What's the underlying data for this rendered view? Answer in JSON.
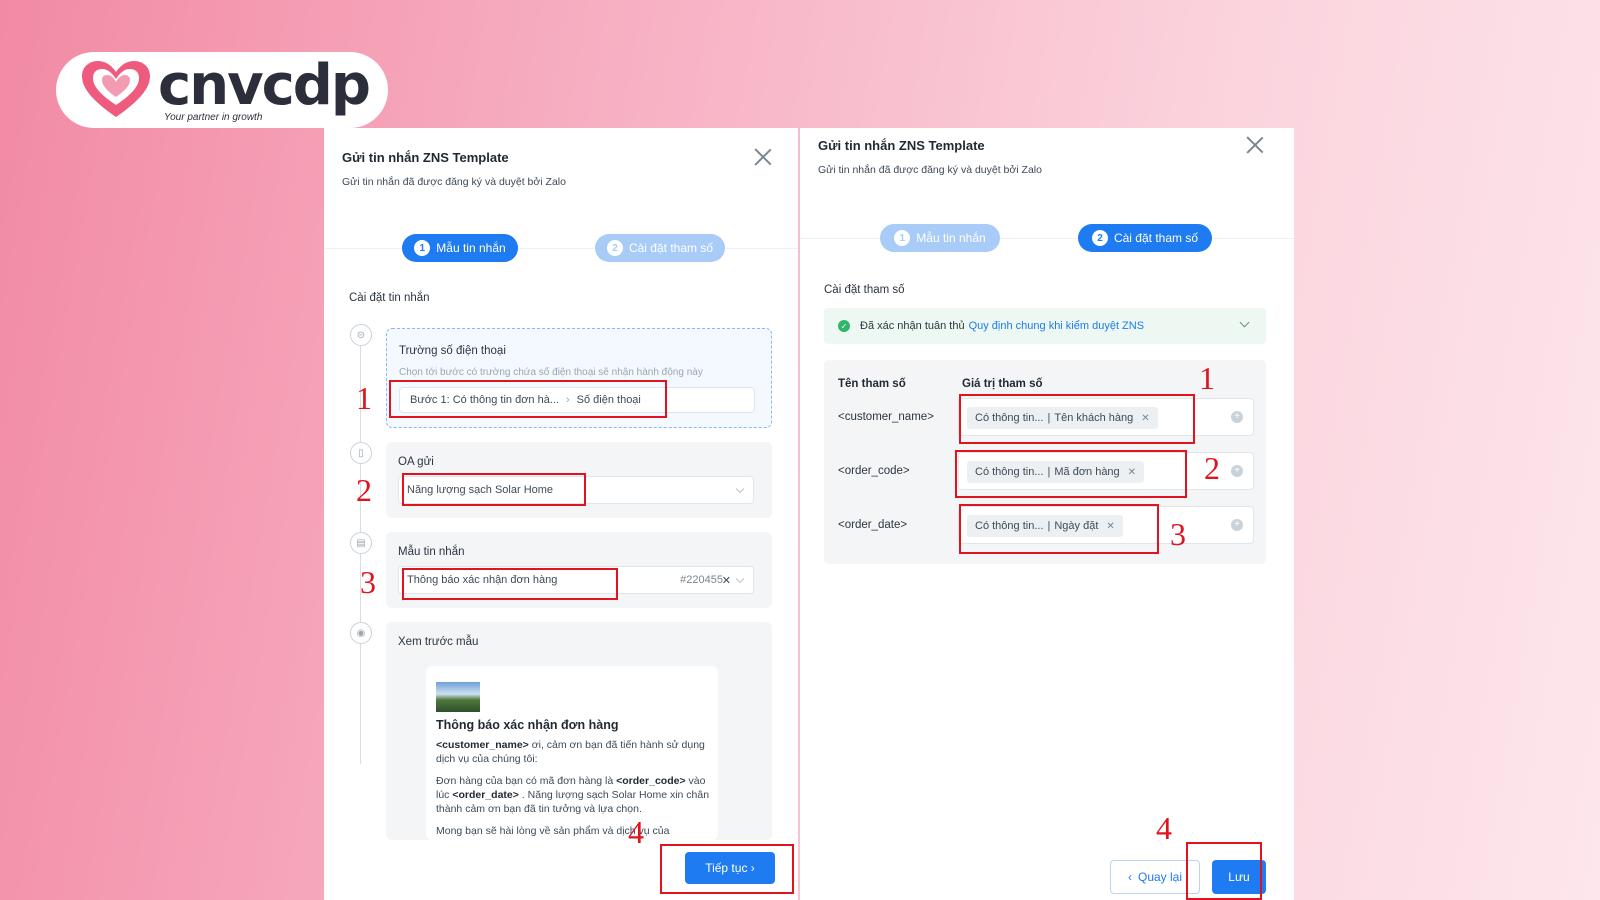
{
  "logo": {
    "word": "cnvcdp",
    "tagline": "Your partner in growth"
  },
  "left": {
    "title": "Gửi tin nhắn ZNS Template",
    "subtitle": "Gửi tin nhắn đã được đăng ký và duyệt bởi Zalo",
    "steps": [
      {
        "num": "1",
        "label": "Mẫu tin nhắn"
      },
      {
        "num": "2",
        "label": "Cài đặt tham số"
      }
    ],
    "section_label": "Cài đặt tin nhắn",
    "phone_card": {
      "title": "Trường số điện thoại",
      "hint": "Chọn tới bước có trường chứa số điện thoại sẽ nhận hành động này",
      "path_step": "Bước 1: Có thông tin đơn hà...",
      "path_field": "Số điện thoại"
    },
    "oa_card": {
      "title": "OA gửi",
      "value": "Năng lượng sạch Solar Home"
    },
    "template_card": {
      "title": "Mẫu tin nhắn",
      "value": "Thông báo xác nhận đơn hàng",
      "code": "#220455"
    },
    "preview_card": {
      "title": "Xem trước mẫu",
      "msg_title": "Thông báo xác nhận đơn hàng",
      "p1_var": "<customer_name>",
      "p1_rest": " ơi, cảm ơn bạn đã tiến hành sử dụng dịch vụ của chúng tôi:",
      "p2_a": "Đơn hàng của bạn có mã đơn hàng là ",
      "p2_var1": "<order_code>",
      "p2_b": " vào lúc ",
      "p2_var2": "<order_date>",
      "p2_c": " . Năng lượng sạch Solar Home xin chân thành cảm ơn bạn đã tin tưởng và lựa chọn.",
      "p3": "Mong bạn sẽ hài lòng về sản phẩm và dịch vụ của"
    },
    "continue_label": "Tiếp tục ›"
  },
  "right": {
    "title": "Gửi tin nhắn ZNS Template",
    "subtitle": "Gửi tin nhắn đã được đăng ký và duyệt bởi Zalo",
    "steps": [
      {
        "num": "1",
        "label": "Mẫu tin nhắn"
      },
      {
        "num": "2",
        "label": "Cài đặt tham số"
      }
    ],
    "section_label": "Cài đặt tham số",
    "notice_text": "Đã xác nhận tuân thủ",
    "notice_link": "Quy định chung khi kiểm duyệt ZNS",
    "col_name": "Tên tham số",
    "col_value": "Giá trị tham số",
    "params": [
      {
        "name": "<customer_name>",
        "source": "Có thông tin...",
        "field": "Tên khách hàng"
      },
      {
        "name": "<order_code>",
        "source": "Có thông tin...",
        "field": "Mã đơn hàng"
      },
      {
        "name": "<order_date>",
        "source": "Có thông tin...",
        "field": "Ngày đặt"
      }
    ],
    "back_label": "Quay lại",
    "save_label": "Lưu"
  },
  "annotations": {
    "left": [
      "1",
      "2",
      "3",
      "4"
    ],
    "right": [
      "1",
      "2",
      "3",
      "4"
    ],
    "color": "#e0141e"
  },
  "colors": {
    "primary": "#1e7bf2",
    "primary_light": "#a8ccf7",
    "success": "#2fb66a"
  }
}
